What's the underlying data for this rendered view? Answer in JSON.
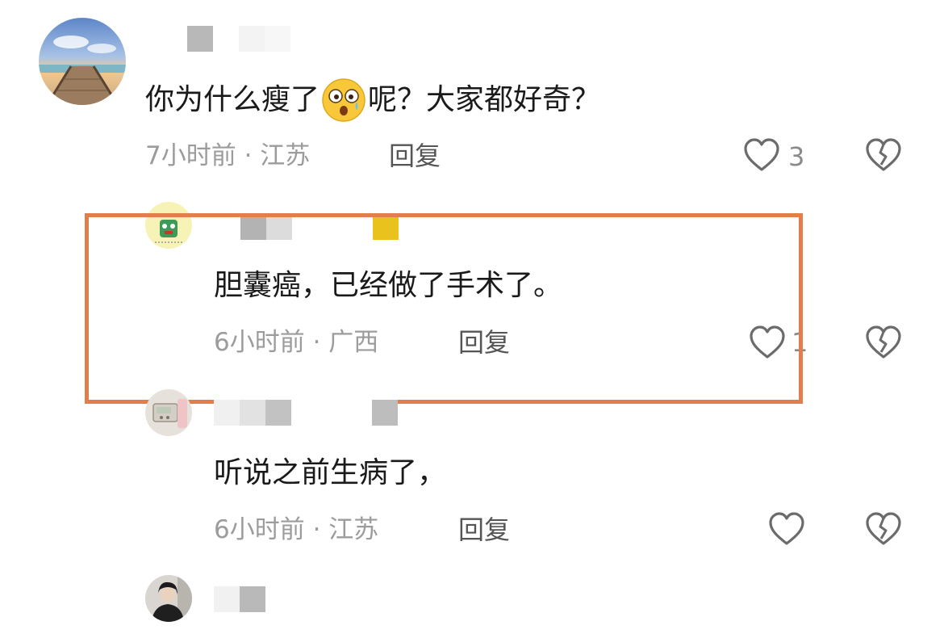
{
  "comments": [
    {
      "text_before_emoji": "你为什么瘦了",
      "text_after_emoji": "呢？大家都好奇？",
      "emoji_icon": "shocked-face-emoji",
      "meta": "7小时前 · 江苏",
      "reply_label": "回复",
      "like_count": "3"
    },
    {
      "text": "胆囊癌，已经做了手术了。",
      "meta": "6小时前 · 广西",
      "reply_label": "回复",
      "like_count": "1"
    },
    {
      "text": "听说之前生病了，",
      "meta": "6小时前 · 江苏",
      "reply_label": "回复"
    }
  ],
  "icons": {
    "like": "heart-outline-icon",
    "dislike": "broken-heart-icon"
  },
  "colors": {
    "highlight_border": "#e27d4c",
    "meta_text": "#9c9c9c",
    "icon_stroke": "#6b6b6b"
  }
}
